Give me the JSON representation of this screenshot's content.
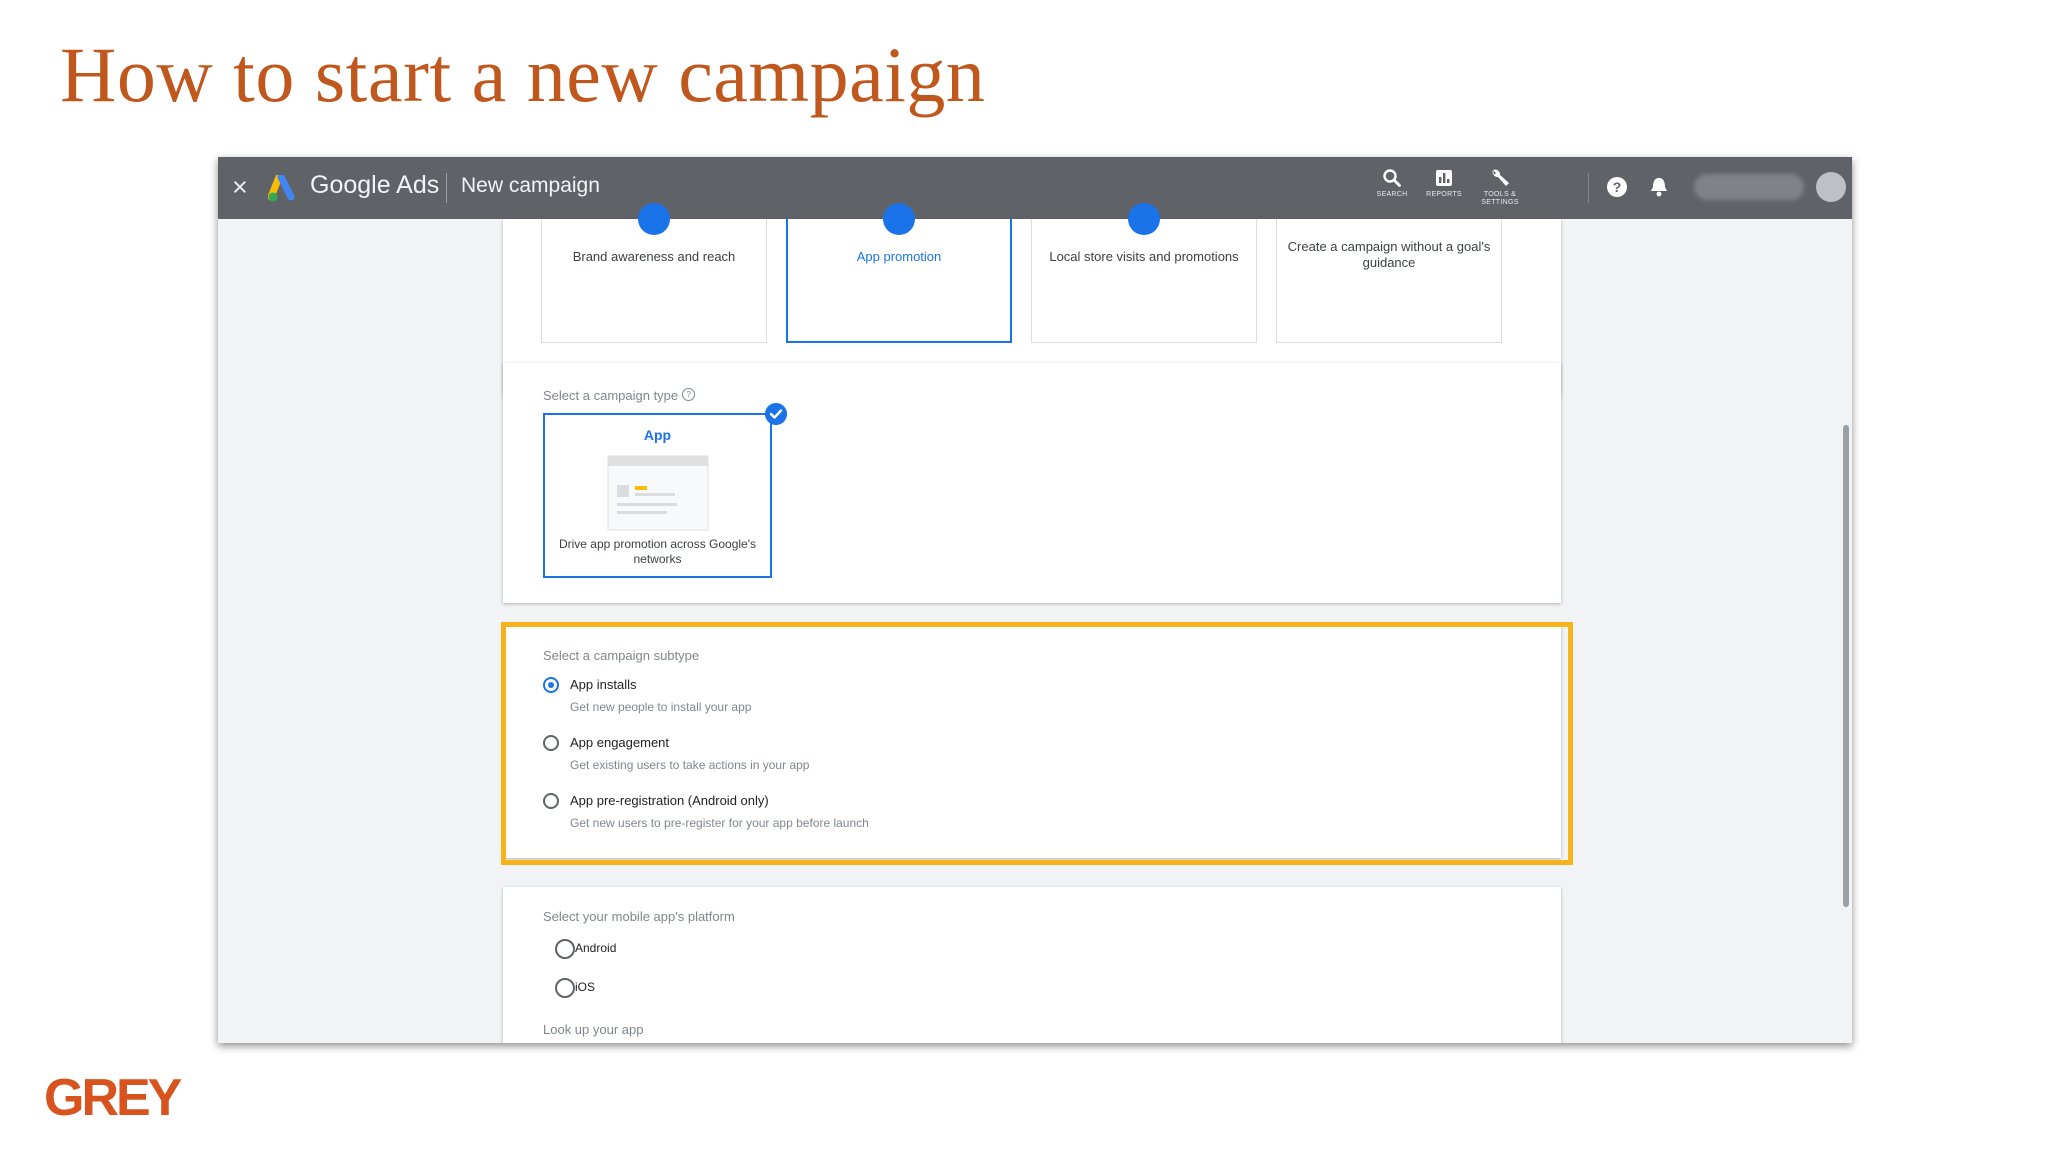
{
  "slide": {
    "title": "How to start a new campaign",
    "logo_text": "GREY",
    "logo_tagline": " "
  },
  "topbar": {
    "close_glyph": "×",
    "brand": "Google Ads",
    "page_name": "New campaign",
    "tools": [
      {
        "icon": "search-icon",
        "label": "SEARCH"
      },
      {
        "icon": "reports-icon",
        "label": "REPORTS"
      },
      {
        "icon": "wrench-icon",
        "label": "TOOLS & SETTINGS"
      }
    ]
  },
  "goals": [
    {
      "label": "Brand awareness and reach",
      "selected": false
    },
    {
      "label": "App promotion",
      "selected": true
    },
    {
      "label": "Local store visits and promotions",
      "selected": false
    },
    {
      "label": "Create a campaign without a goal's guidance",
      "selected": false
    }
  ],
  "campaign_type": {
    "section_label": "Select a campaign type",
    "help_glyph": "?",
    "card_title": "App",
    "card_description": "Drive app promotion across Google's networks"
  },
  "subtype": {
    "section_label": "Select a campaign subtype",
    "options": [
      {
        "label": "App installs",
        "description": "Get new people to install your app",
        "selected": true
      },
      {
        "label": "App engagement",
        "description": "Get existing users to take actions in your app",
        "selected": false
      },
      {
        "label": "App pre-registration (Android only)",
        "description": "Get new users to pre-register for your app before launch",
        "selected": false
      }
    ]
  },
  "platform": {
    "section_label": "Select your mobile app's platform",
    "options": [
      "Android",
      "iOS"
    ],
    "lookup_label": "Look up your app"
  },
  "colors": {
    "accent": "#1a73e8",
    "highlight": "#f6b31b",
    "title": "#c0581e",
    "topbar": "#5f6368",
    "brand_logo": "#d9531e"
  }
}
